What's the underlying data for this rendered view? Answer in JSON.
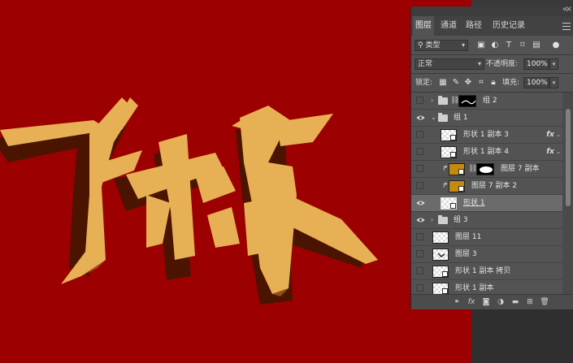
{
  "panel": {
    "tabs": [
      {
        "label": "图层",
        "active": true
      },
      {
        "label": "通道",
        "active": false
      },
      {
        "label": "路径",
        "active": false
      },
      {
        "label": "历史记录",
        "active": false
      }
    ],
    "filter_select": "类型",
    "blend_mode": "正常",
    "opacity_label": "不透明度:",
    "opacity_value": "100%",
    "lock_label": "锁定:",
    "fill_label": "填充:",
    "fill_value": "100%"
  },
  "layers": [
    {
      "name": "组 2",
      "type": "group",
      "visible": false,
      "expanded": false,
      "indent": 0,
      "mask": true
    },
    {
      "name": "组 1",
      "type": "group",
      "visible": true,
      "expanded": true,
      "indent": 0
    },
    {
      "name": "形状 1 副本 3",
      "type": "smart",
      "visible": false,
      "fx": true,
      "indent": 1
    },
    {
      "name": "形状 1 副本 4",
      "type": "smart",
      "visible": false,
      "fx": true,
      "indent": 1
    },
    {
      "name": "图层 7 副本",
      "type": "pixel",
      "visible": false,
      "clipped": true,
      "mask": true,
      "indent": 1
    },
    {
      "name": "图层 7 副本 2",
      "type": "pixel",
      "visible": false,
      "clipped": true,
      "indent": 1
    },
    {
      "name": "形状 1",
      "type": "smart",
      "visible": true,
      "selected": true,
      "indent": 1
    },
    {
      "name": "组 3",
      "type": "group",
      "visible": true,
      "expanded": false,
      "indent": 0
    },
    {
      "name": "图层 11",
      "type": "pixel",
      "visible": false,
      "indent": 0
    },
    {
      "name": "图层 3",
      "type": "pixel",
      "visible": false,
      "indent": 0
    },
    {
      "name": "形状 1 副本 拷贝",
      "type": "smart",
      "visible": false,
      "indent": 0
    },
    {
      "name": "形状 1 副本",
      "type": "smart",
      "visible": false,
      "indent": 0
    }
  ],
  "colors": {
    "canvas": "#9c0000",
    "gold": "#e7b055",
    "shadow": "#4a1400",
    "panel": "#535353"
  }
}
